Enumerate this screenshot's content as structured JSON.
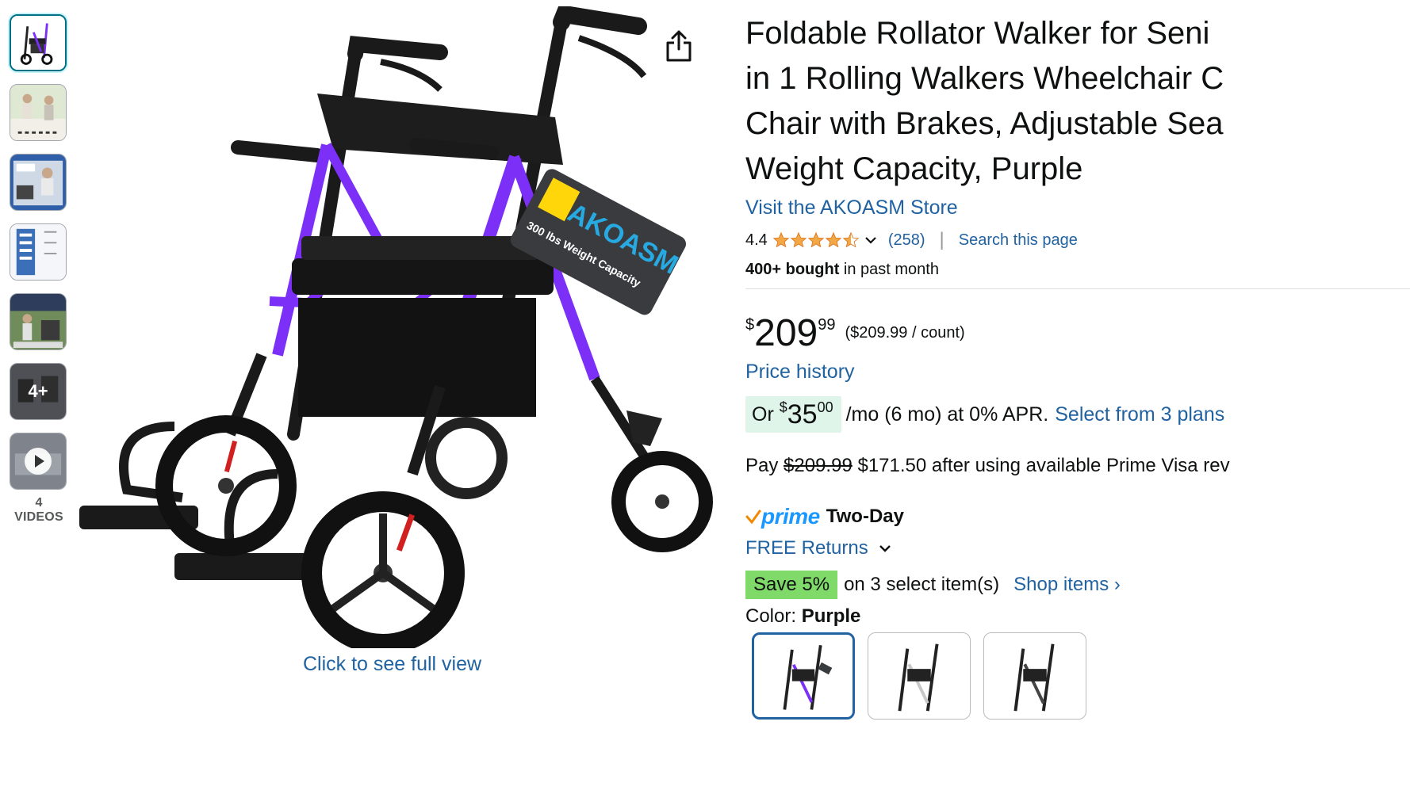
{
  "gallery": {
    "thumbnails": [
      {
        "name": "thumb-walker-purple"
      },
      {
        "name": "thumb-lifestyle-1"
      },
      {
        "name": "thumb-lifestyle-2"
      },
      {
        "name": "thumb-infographic"
      },
      {
        "name": "thumb-lifestyle-3"
      },
      {
        "name": "thumb-more",
        "overlay": "4+"
      },
      {
        "name": "thumb-video"
      }
    ],
    "videos_label": "4 VIDEOS",
    "full_view_label": "Click to see full view",
    "tag_brand": "AKOASM",
    "tag_text": "300 lbs Weight Capacity"
  },
  "product": {
    "title_lines": [
      "Foldable Rollator Walker for Seni",
      "in 1 Rolling Walkers Wheelchair C",
      "Chair with Brakes, Adjustable Sea",
      "Weight Capacity, Purple"
    ],
    "store_link": "Visit the AKOASM Store",
    "rating": "4.4",
    "rating_count": "(258)",
    "search_page": "Search this page",
    "bought_bold": "400+ bought",
    "bought_rest": " in past month",
    "price": {
      "symbol": "$",
      "whole": "209",
      "fraction": "99",
      "unit_price": "($209.99 / count)"
    },
    "price_history": "Price history",
    "monthly": {
      "prefix": "Or ",
      "symbol": "$",
      "whole": "35",
      "fraction": "00",
      "text": "/mo (6 mo) at 0% APR.",
      "link": "Select from 3 plans"
    },
    "visa": {
      "pay": "Pay ",
      "old_price": "$209.99",
      "rest": " $171.50 after using available Prime Visa rev"
    },
    "prime": {
      "word": "prime",
      "delivery": "Two-Day"
    },
    "returns": "FREE Returns",
    "save": {
      "badge": "Save 5%",
      "text": "on 3 select item(s)",
      "link": "Shop items ›"
    },
    "color": {
      "label": "Color: ",
      "value": "Purple"
    }
  },
  "colors": {
    "purple": "#7b2ff7",
    "link": "#2162a1",
    "star": "#f3a847",
    "save_green": "#7fda69",
    "pill_green": "#dff5ea"
  }
}
